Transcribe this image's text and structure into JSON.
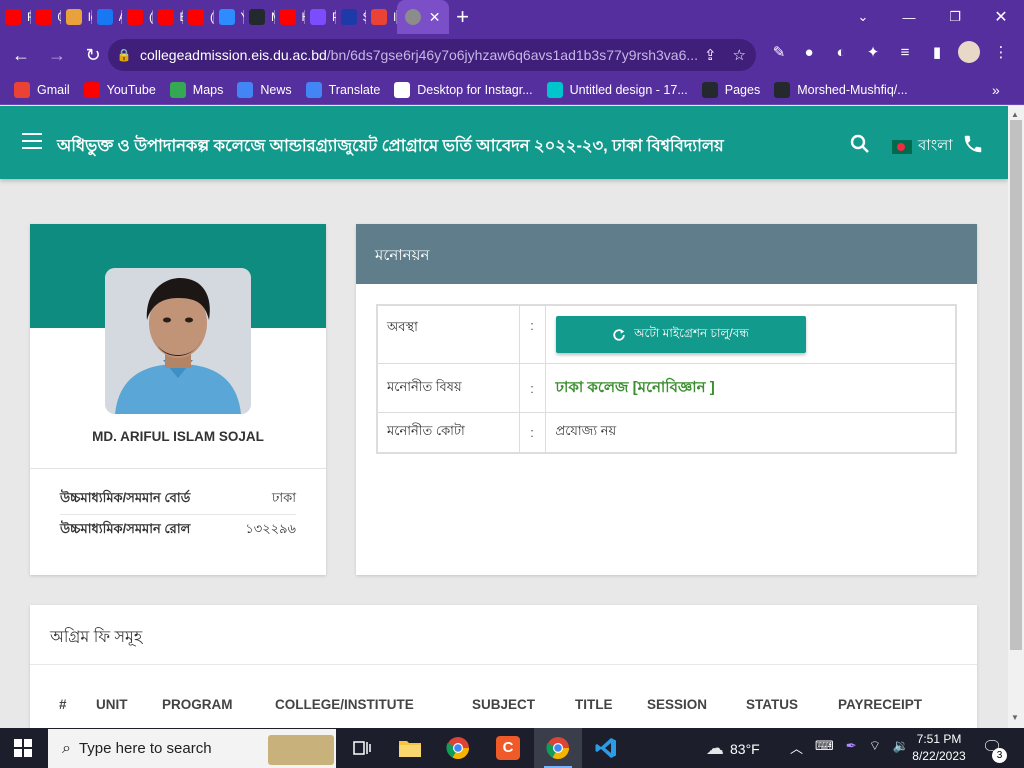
{
  "browser": {
    "tabs": [
      {
        "title": "Re",
        "icon": "youtube-icon",
        "color": "#ff0000"
      },
      {
        "title": "01",
        "icon": "youtube-icon",
        "color": "#ff0000"
      },
      {
        "title": "loc",
        "icon": "tower-icon",
        "color": "#e9a23b"
      },
      {
        "title": "Ari",
        "icon": "facebook-icon",
        "color": "#1877f2"
      },
      {
        "title": "(1'",
        "icon": "youtube-icon",
        "color": "#ff0000"
      },
      {
        "title": "Bo",
        "icon": "youtube-icon",
        "color": "#ff0000"
      },
      {
        "title": "(6)",
        "icon": "youtube-icon",
        "color": "#ff0000"
      },
      {
        "title": "Yt",
        "icon": "ytdl-icon",
        "color": "#2d8cff"
      },
      {
        "title": "Mo",
        "icon": "github-icon",
        "color": "#24292e"
      },
      {
        "title": "Ho",
        "icon": "youtube-icon",
        "color": "#ff0000"
      },
      {
        "title": "Pa",
        "icon": "s-icon",
        "color": "#7c4dff"
      },
      {
        "title": "Sk",
        "icon": "b-icon",
        "color": "#1e3aa8"
      },
      {
        "title": "Inl",
        "icon": "gmail-icon",
        "color": "#ea4335"
      }
    ],
    "url_host": "collegeadmission.eis.du.ac.bd",
    "url_path": "/bn/6ds7gse6rj46y7o6jyhzaw6q6avs1ad1b3s77y9rsh3va6...",
    "bookmarks": [
      {
        "label": "Gmail",
        "icon": "gmail-icon",
        "color": "#ea4335"
      },
      {
        "label": "YouTube",
        "icon": "youtube-icon",
        "color": "#ff0000"
      },
      {
        "label": "Maps",
        "icon": "maps-icon",
        "color": "#34a853"
      },
      {
        "label": "News",
        "icon": "news-icon",
        "color": "#4285f4"
      },
      {
        "label": "Translate",
        "icon": "translate-icon",
        "color": "#4285f4"
      },
      {
        "label": "Desktop for Instagr...",
        "icon": "globe-icon",
        "color": "#ffffff"
      },
      {
        "label": "Untitled design - 17...",
        "icon": "canva-icon",
        "color": "#00c4cc"
      },
      {
        "label": "Pages",
        "icon": "github-icon",
        "color": "#24292e"
      },
      {
        "label": "Morshed-Mushfiq/...",
        "icon": "github-icon",
        "color": "#24292e"
      }
    ]
  },
  "header": {
    "title": "অধিভুক্ত ও উপাদানকল্প কলেজে আন্ডারগ্র্যাজুয়েট প্রোগ্রামে ভর্তি আবেদন ২০২২-২৩, ঢাকা বিশ্ববিদ্যালয়",
    "language": "বাংলা"
  },
  "profile": {
    "name": "MD. ARIFUL ISLAM SOJAL",
    "rows": [
      {
        "label": "উচ্চমাধ্যমিক/সমমান বোর্ড",
        "value": "ঢাকা"
      },
      {
        "label": "উচ্চমাধ্যমিক/সমমান রোল",
        "value": "১৩২২৯৬"
      }
    ]
  },
  "nomination": {
    "heading": "মনোনয়ন",
    "status_label": "অবস্থা",
    "migration_button": "অটো মাইগ্রেশন চালু/বন্ধ",
    "subject_label": "মনোনীত বিষয়",
    "subject_value": "ঢাকা কলেজ [মনোবিজ্ঞান ]",
    "quota_label": "মনোনীত কোটা",
    "quota_value": "প্রযোজ্য নয়",
    "separator": ":"
  },
  "fees": {
    "heading": "অগ্রিম ফি সমূহ",
    "columns": [
      "#",
      "UNIT",
      "PROGRAM",
      "COLLEGE/INSTITUTE",
      "SUBJECT",
      "TITLE",
      "SESSION",
      "STATUS",
      "PAYRECEIPT"
    ]
  },
  "taskbar": {
    "search_placeholder": "Type here to search",
    "temperature": "83°F",
    "time": "7:51 PM",
    "date": "8/22/2023",
    "notification_count": "3"
  },
  "colors": {
    "browser_chrome": "#562f9e",
    "appbar": "#129a8c",
    "nomination_header": "#5f7d8a",
    "subject_text": "#3a8f2e"
  }
}
